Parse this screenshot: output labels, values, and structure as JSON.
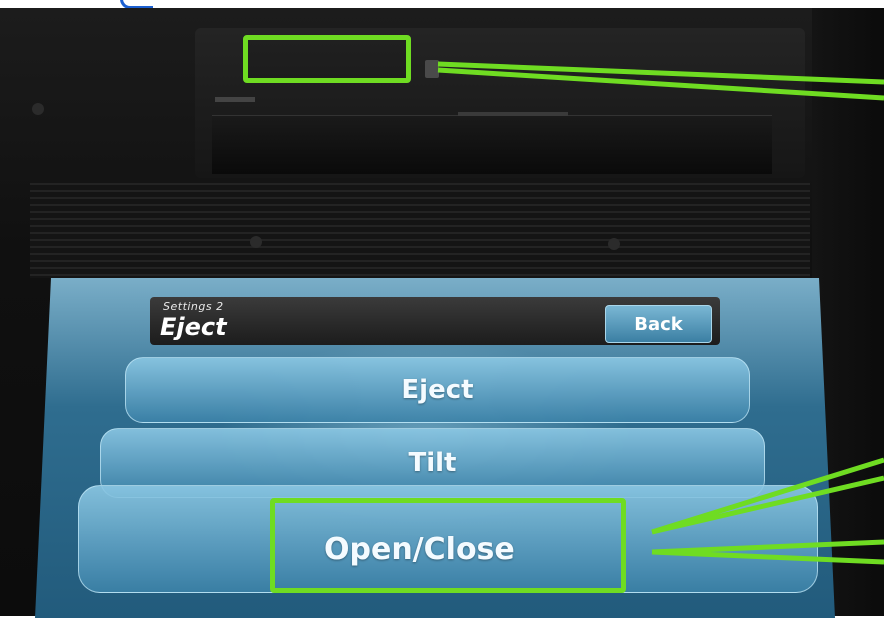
{
  "screen": {
    "subtitle": "Settings 2",
    "title": "Eject",
    "back_label": "Back",
    "buttons": [
      "Eject",
      "Tilt",
      "Open/Close"
    ]
  },
  "colors": {
    "highlight": "#6fdc22",
    "screen_blue": "#2f6d8f",
    "device_body": "#151515"
  }
}
